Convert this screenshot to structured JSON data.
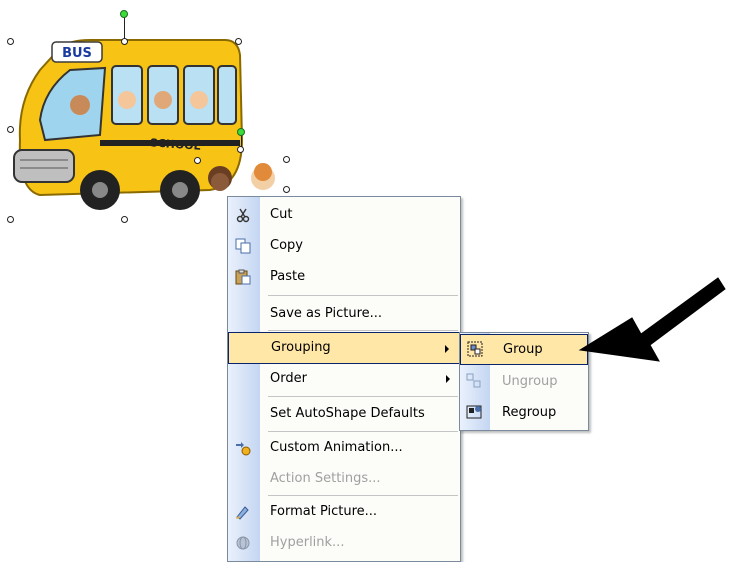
{
  "clipart": {
    "bus_sign": "BUS",
    "bus_side_text": "SCHOOL"
  },
  "context_menu": {
    "items": [
      {
        "label": "Cut",
        "icon": "scissors-icon",
        "enabled": true
      },
      {
        "label": "Copy",
        "icon": "copy-icon",
        "enabled": true
      },
      {
        "label": "Paste",
        "icon": "paste-icon",
        "enabled": true
      },
      {
        "label": "Save as Picture...",
        "enabled": true
      },
      {
        "label": "Grouping",
        "enabled": true,
        "highlighted": true,
        "has_submenu": true
      },
      {
        "label": "Order",
        "enabled": true,
        "has_submenu": true
      },
      {
        "label": "Set AutoShape Defaults",
        "enabled": true
      },
      {
        "label": "Custom Animation...",
        "icon": "animation-icon",
        "enabled": true
      },
      {
        "label": "Action Settings...",
        "enabled": false
      },
      {
        "label": "Format Picture...",
        "icon": "format-picture-icon",
        "enabled": true
      },
      {
        "label": "Hyperlink...",
        "icon": "hyperlink-icon",
        "enabled": false
      }
    ]
  },
  "grouping_submenu": {
    "items": [
      {
        "label": "Group",
        "icon": "group-icon",
        "enabled": true,
        "highlighted": true
      },
      {
        "label": "Ungroup",
        "icon": "ungroup-icon",
        "enabled": false
      },
      {
        "label": "Regroup",
        "icon": "regroup-icon",
        "enabled": true
      }
    ]
  },
  "colors": {
    "highlight": "#ffe7a8",
    "highlight_border": "#0a246a",
    "menu_bg": "#fcfcf9",
    "gutter": "#c4d6f2",
    "bus_yellow": "#f7c416"
  }
}
